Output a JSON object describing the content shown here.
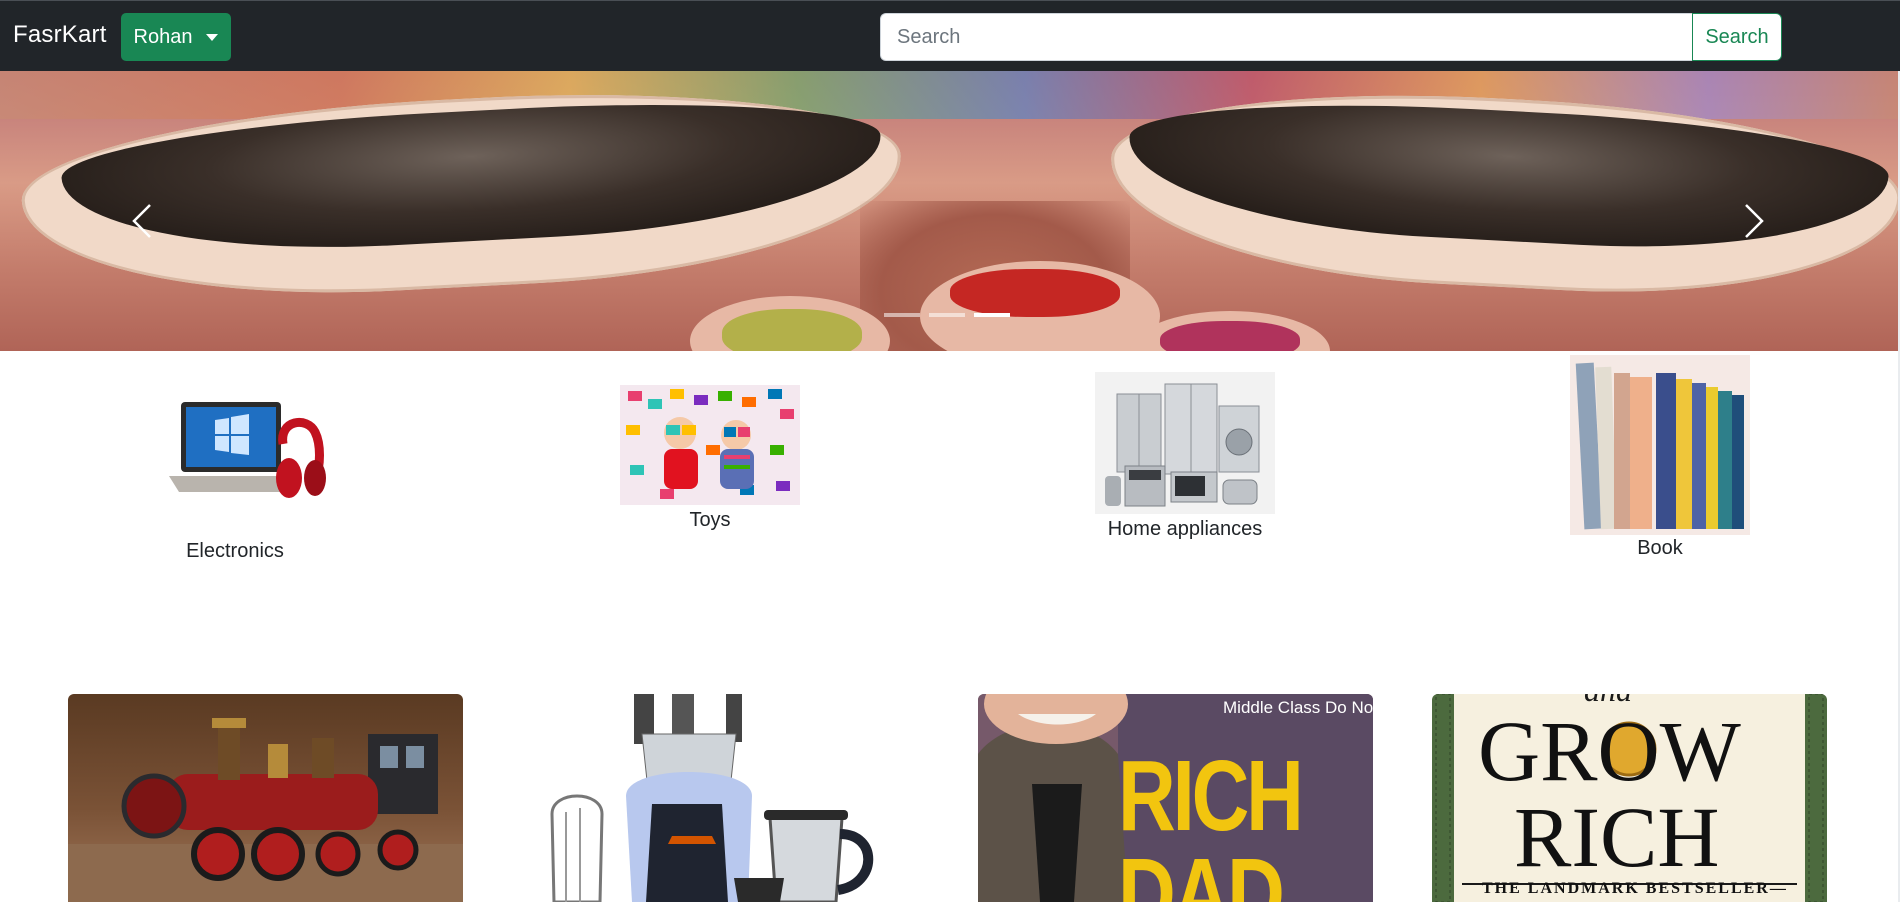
{
  "navbar": {
    "brand": "FasrKart",
    "user_menu_label": "Rohan",
    "search_placeholder": "Search",
    "search_button_label": "Search",
    "colors": {
      "background": "#212529",
      "accent": "#198754"
    }
  },
  "carousel": {
    "slide_count": 3,
    "active_slide": 3,
    "prev_icon": "chevron-left-icon",
    "next_icon": "chevron-right-icon"
  },
  "categories": [
    {
      "label": "Electronics"
    },
    {
      "label": "Toys"
    },
    {
      "label": "Home appliances"
    },
    {
      "label": "Book"
    }
  ],
  "products": {
    "card_1": {
      "image": "toy-train-image"
    },
    "card_2": {
      "image": "mixer-grinder-image"
    },
    "card_3": {
      "image": "rich-dad-book-cover",
      "cover_tagline": "Middle Class Do Not!",
      "cover_line_1": "RICH",
      "cover_line_2": "DAD"
    },
    "card_4": {
      "image": "grow-rich-book-cover",
      "cover_top": "and",
      "cover_line_1": "GROW",
      "cover_line_2": "RICH",
      "cover_tagline": "THE LANDMARK BESTSELLER—"
    }
  }
}
